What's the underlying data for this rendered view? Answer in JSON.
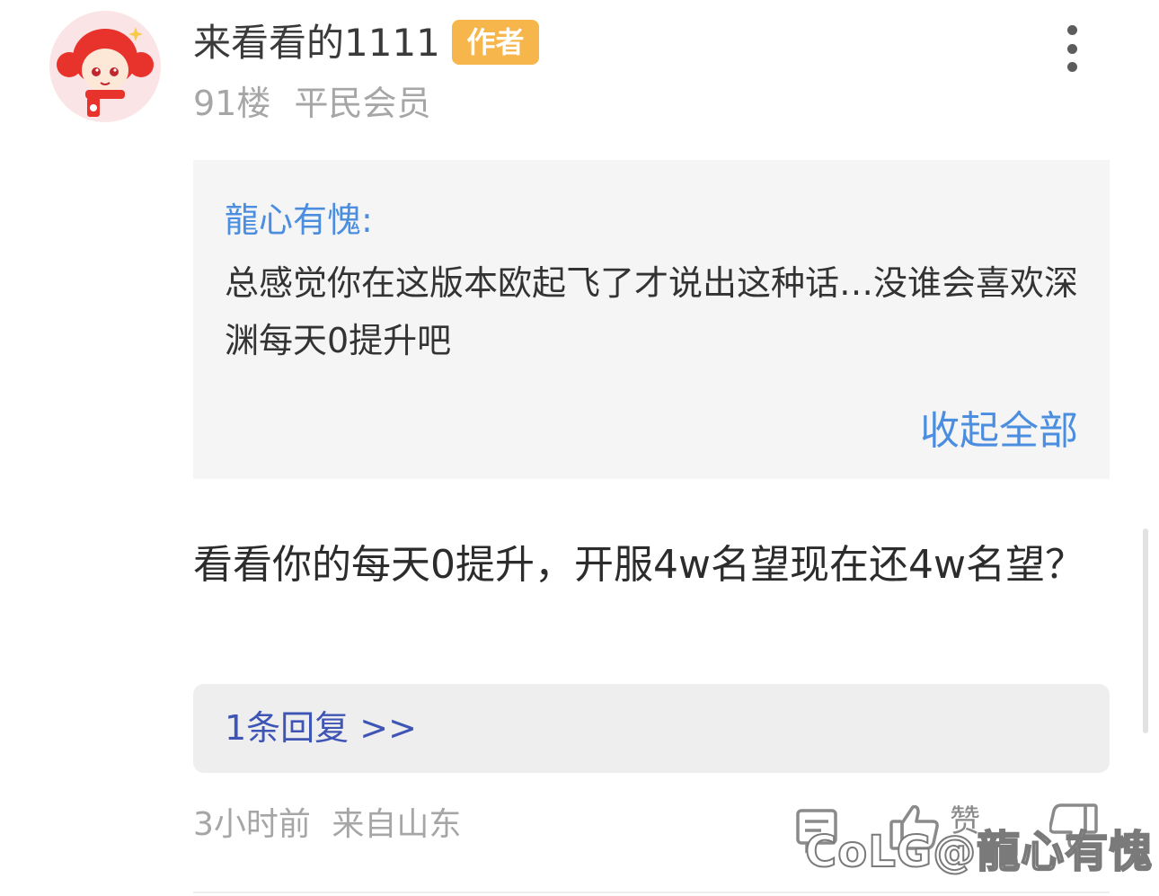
{
  "post": {
    "username": "来看看的1111",
    "badge": "作者",
    "floor": "91楼",
    "rank": "平民会员"
  },
  "quote": {
    "user": "龍心有愧:",
    "text": "总感觉你在这版本欧起飞了才说出这种话…没谁会喜欢深渊每天0提升吧",
    "collapse_label": "收起全部"
  },
  "reply": {
    "text": "看看你的每天0提升，开服4w名望现在还4w名望？"
  },
  "subreplies": {
    "link_label": "1条回复 >>"
  },
  "footer": {
    "time": "3小时前",
    "location": "来自山东",
    "like_label": "赞"
  },
  "watermark": "CoLG@龍心有愧",
  "icons": {
    "avatar": "girl-avatar",
    "more": "more-vertical-icon",
    "reply": "comment-icon",
    "like": "thumbs-up-icon",
    "dislike": "thumbs-down-icon"
  },
  "colors": {
    "badge": "#f7b64c",
    "link_blue": "#4b8ee0",
    "subreply_blue": "#3f55b5"
  }
}
